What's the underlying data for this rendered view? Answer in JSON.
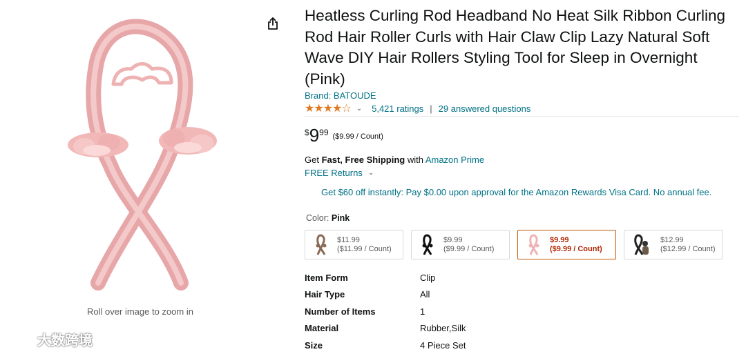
{
  "product": {
    "title": "Heatless Curling Rod Headband No Heat Silk Ribbon Curling Rod Hair Roller Curls with Hair Claw Clip Lazy Natural Soft Wave DIY Hair Rollers Styling Tool for Sleep in Overnight (Pink)",
    "brand": "Brand: BATOUDE",
    "rating_value": 4.3,
    "ratings_count": "5,421 ratings",
    "answered_questions": "29 answered questions"
  },
  "price": {
    "symbol": "$",
    "whole": "9",
    "fraction": "99",
    "unit_price": "($9.99 / Count)"
  },
  "shipping": {
    "prefix": "Get ",
    "bold": "Fast, Free Shipping",
    "middle": " with ",
    "prime": "Amazon Prime"
  },
  "returns": {
    "label": "FREE Returns"
  },
  "promo": "Get $60 off instantly: Pay $0.00 upon approval for the Amazon Rewards Visa Card. No annual fee.",
  "color": {
    "label": "Color:",
    "selected": "Pink"
  },
  "swatches": [
    {
      "price": "$11.99",
      "unit": "($11.99 / Count)",
      "selected": false
    },
    {
      "price": "$9.99",
      "unit": "($9.99 / Count)",
      "selected": false
    },
    {
      "price": "$9.99",
      "unit": "($9.99 / Count)",
      "selected": true
    },
    {
      "price": "$12.99",
      "unit": "($12.99 / Count)",
      "selected": false
    }
  ],
  "specs": [
    {
      "key": "Item Form",
      "value": "Clip"
    },
    {
      "key": "Hair Type",
      "value": "All"
    },
    {
      "key": "Number of Items",
      "value": "1"
    },
    {
      "key": "Material",
      "value": "Rubber,Silk"
    },
    {
      "key": "Size",
      "value": "4 Piece Set"
    }
  ],
  "image": {
    "zoom_hint": "Roll over image to zoom in"
  },
  "watermark": "大数跨境",
  "icons": {
    "share": "share-icon",
    "chevron": "chevron-down-icon",
    "star": "star-icon"
  },
  "colors": {
    "link": "#007185",
    "star": "#de7921",
    "selected_border": "#c45500",
    "selected_price": "#b12704",
    "product_pink": "#f2b8b8"
  }
}
